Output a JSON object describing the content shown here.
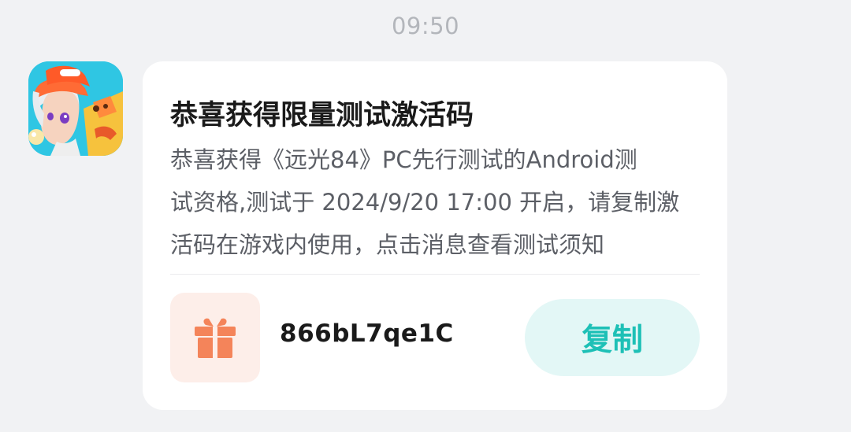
{
  "time_divider": "09:50",
  "sender": {
    "avatar_icon": "game-character-avatar-icon"
  },
  "message": {
    "title": "恭喜获得限量测试激活码",
    "body_lines": [
      "恭喜获得《远光84》PC先行测试的Android测",
      "试资格,测试于 2024/9/20 17:00 开启，请复制激",
      "活码在游戏内使用，点击消息查看测试须知"
    ],
    "gift_icon": "gift-icon",
    "activation_code": "866bL7qe1C",
    "copy_label": "复制"
  },
  "colors": {
    "accent": "#1dc0b6",
    "copy_bg": "#e3f7f6",
    "gift": "#f4845a",
    "gift_bg": "#fdeee9",
    "page_bg": "#f1f2f4"
  }
}
